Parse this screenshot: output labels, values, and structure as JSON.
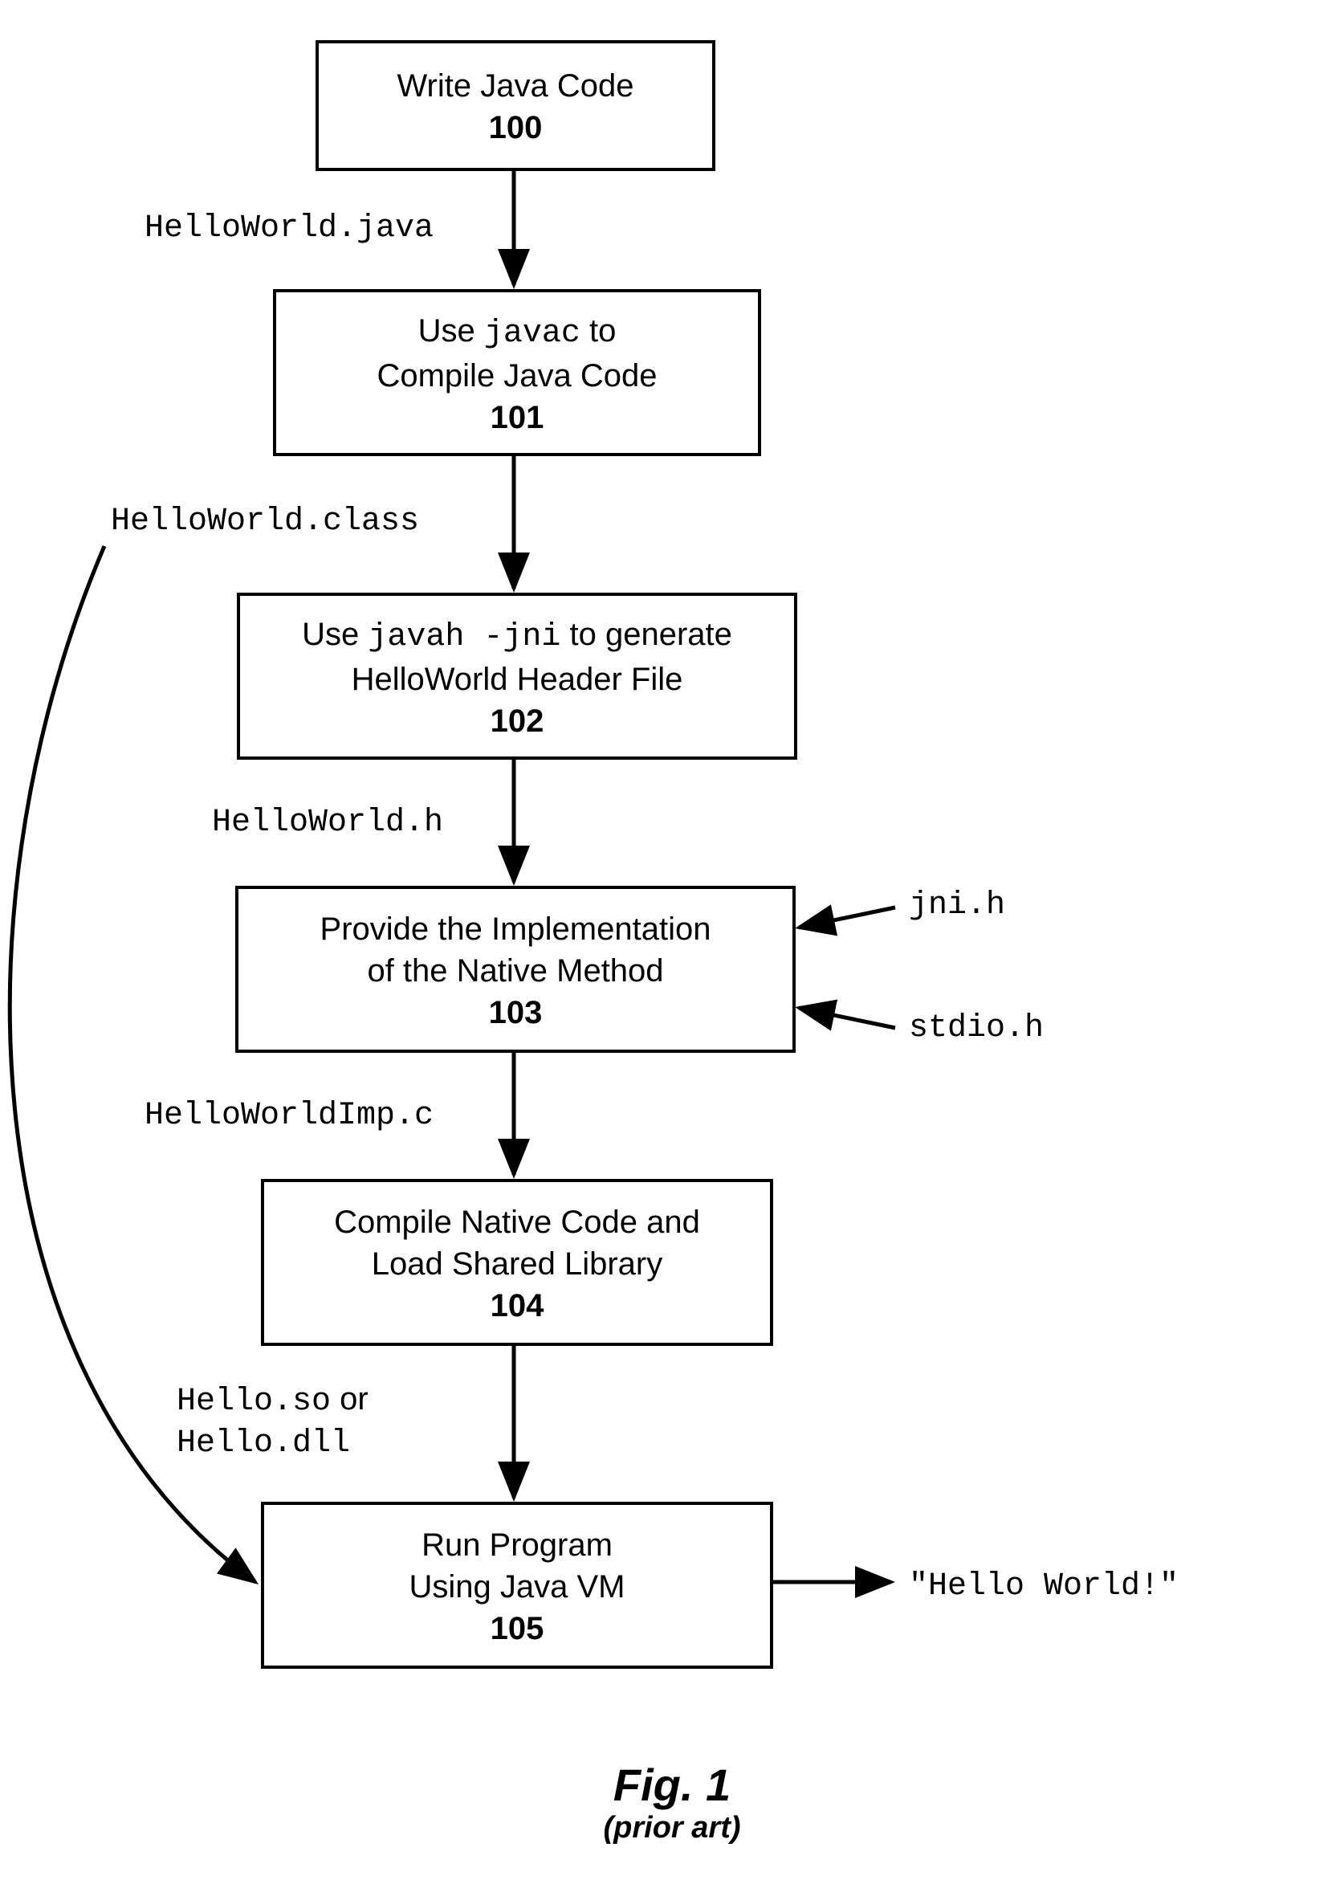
{
  "chart_data": {
    "type": "flowchart",
    "nodes": [
      {
        "id": "100",
        "text": "Write Java Code"
      },
      {
        "id": "101",
        "text": "Use javac to Compile Java Code"
      },
      {
        "id": "102",
        "text": "Use javah -jni to generate HelloWorld Header File"
      },
      {
        "id": "103",
        "text": "Provide the Implementation of the Native Method"
      },
      {
        "id": "104",
        "text": "Compile Native Code and Load Shared Library"
      },
      {
        "id": "105",
        "text": "Run Program Using Java VM"
      }
    ],
    "edges": [
      {
        "from": "100",
        "to": "101",
        "label": "HelloWorld.java"
      },
      {
        "from": "101",
        "to": "102",
        "label": "HelloWorld.class"
      },
      {
        "from": "102",
        "to": "103",
        "label": "HelloWorld.h"
      },
      {
        "from": "103",
        "to": "104",
        "label": "HelloWorldImp.c"
      },
      {
        "from": "104",
        "to": "105",
        "label": "Hello.so or Hello.dll"
      },
      {
        "from": "101",
        "to": "105",
        "label": "(HelloWorld.class bypass)"
      }
    ],
    "side_inputs_103": [
      "jni.h",
      "stdio.h"
    ],
    "output_105": "\"Hello World!\"",
    "title": "Fig. 1",
    "subtitle": "(prior art)"
  },
  "boxes": {
    "b100": {
      "line1": "Write Java Code",
      "num": "100"
    },
    "b101": {
      "pre": "Use ",
      "mono": "javac",
      "post": " to",
      "line2": "Compile Java Code",
      "num": "101"
    },
    "b102": {
      "pre": "Use ",
      "mono": "javah -jni",
      "post": " to generate",
      "line2": "HelloWorld Header File",
      "num": "102"
    },
    "b103": {
      "line1": "Provide the Implementation",
      "line2": "of the Native Method",
      "num": "103"
    },
    "b104": {
      "line1": "Compile Native Code and",
      "line2": "Load Shared Library",
      "num": "104"
    },
    "b105": {
      "line1": "Run Program",
      "line2": "Using Java VM",
      "num": "105"
    }
  },
  "edge_labels": {
    "e1": "HelloWorld.java",
    "e2": "HelloWorld.class",
    "e3": "HelloWorld.h",
    "e4": "HelloWorldImp.c",
    "e5a": "Hello.so",
    "e5_or": " or",
    "e5b": "Hello.dll"
  },
  "side_inputs": {
    "jni": "jni.h",
    "stdio": "stdio.h"
  },
  "output": "\"Hello World!\"",
  "figure": {
    "title": "Fig. 1",
    "subtitle": "(prior art)"
  }
}
